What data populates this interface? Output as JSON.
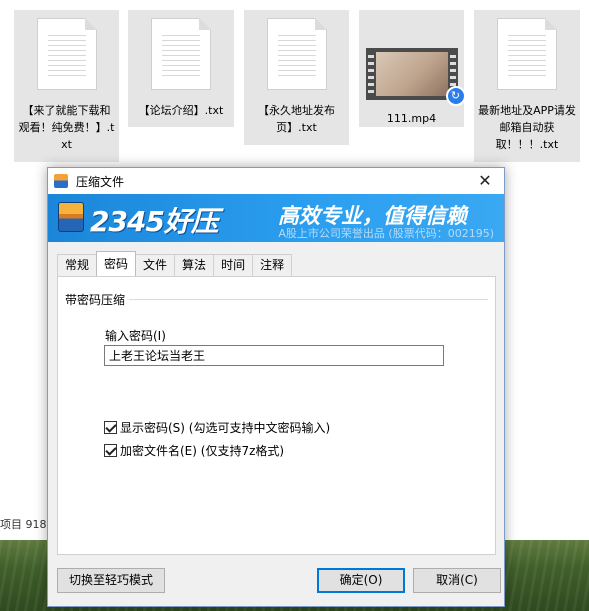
{
  "desktop": {
    "files": [
      {
        "label": "【来了就能下载和观看！纯免费！】.txt",
        "type": "txt"
      },
      {
        "label": "【论坛介绍】.txt",
        "type": "txt"
      },
      {
        "label": "【永久地址发布页】.txt",
        "type": "txt"
      },
      {
        "label": "111.mp4",
        "type": "video"
      },
      {
        "label": "最新地址及APP请发邮箱自动获取！！！.txt",
        "type": "txt"
      }
    ],
    "status_text": "项目  918"
  },
  "dialog": {
    "title": "压缩文件",
    "close_icon": "close-icon",
    "banner": {
      "brand": "2345好压",
      "slogan": "高效专业，值得信赖",
      "subtitle": "A股上市公司荣誉出品 (股票代码：002195)"
    },
    "tabs": [
      {
        "label": "常规",
        "active": false
      },
      {
        "label": "密码",
        "active": true
      },
      {
        "label": "文件",
        "active": false
      },
      {
        "label": "算法",
        "active": false
      },
      {
        "label": "时间",
        "active": false
      },
      {
        "label": "注释",
        "active": false
      }
    ],
    "group_title": "带密码压缩",
    "password_label": "输入密码(I)",
    "password_value": "上老王论坛当老王",
    "show_password": {
      "label": "显示密码(S) (勾选可支持中文密码输入)",
      "checked": true
    },
    "encrypt_filenames": {
      "label": "加密文件名(E) (仅支持7z格式)",
      "checked": true
    },
    "buttons": {
      "lite_mode": "切换至轻巧模式",
      "ok": "确定(O)",
      "cancel": "取消(C)"
    }
  },
  "colors": {
    "banner": "#1b86d9",
    "accent": "#0078d7"
  }
}
